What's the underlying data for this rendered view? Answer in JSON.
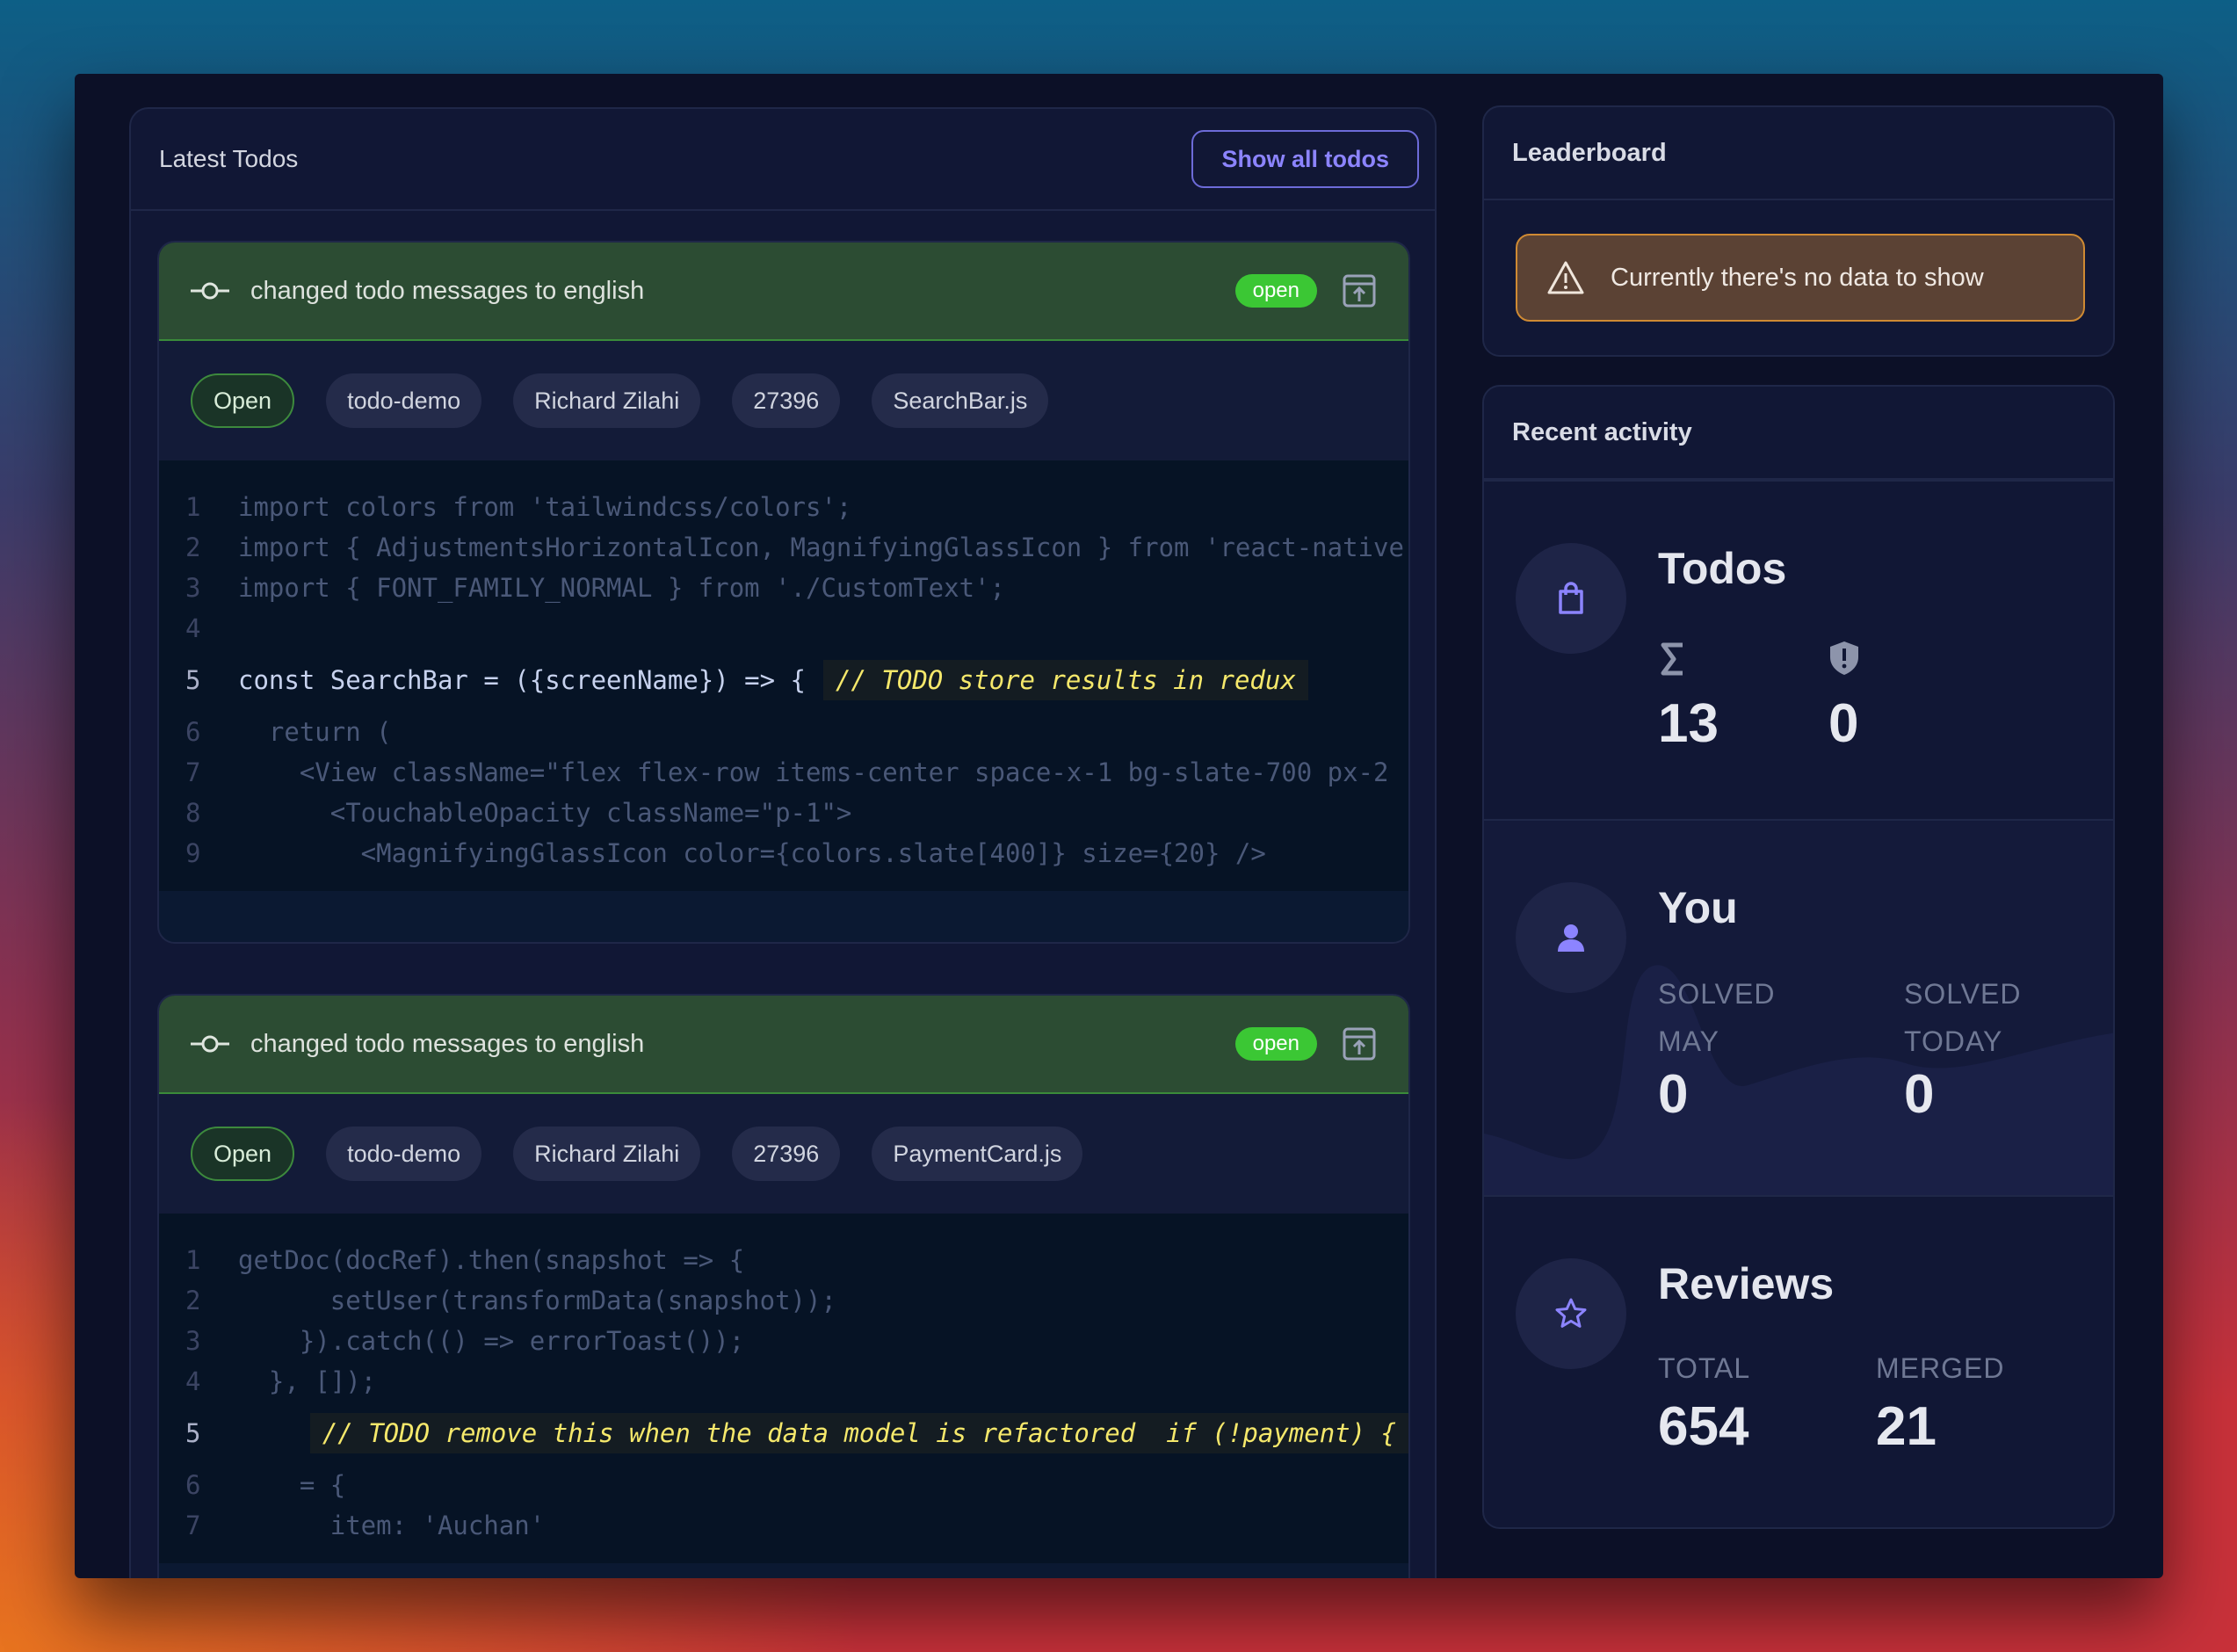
{
  "todos": {
    "title": "Latest Todos",
    "show_all_label": "Show all todos",
    "cards": [
      {
        "title": "changed todo messages to english",
        "status_pill": "open",
        "chips": [
          "Open",
          "todo-demo",
          "Richard Zilahi",
          "27396",
          "SearchBar.js"
        ],
        "code": [
          {
            "n": "1",
            "text": "import colors from 'tailwindcss/colors';"
          },
          {
            "n": "2",
            "text": "import { AdjustmentsHorizontalIcon, MagnifyingGlassIcon } from 'react-native"
          },
          {
            "n": "3",
            "text": "import { FONT_FAMILY_NORMAL } from './CustomText';"
          },
          {
            "n": "4",
            "text": ""
          },
          {
            "n": "5",
            "text": "const SearchBar = ({screenName}) => {",
            "comment": "// TODO store results in redux"
          },
          {
            "n": "6",
            "text": "  return ("
          },
          {
            "n": "7",
            "text": "    <View className=\"flex flex-row items-center space-x-1 bg-slate-700 px-2"
          },
          {
            "n": "8",
            "text": "      <TouchableOpacity className=\"p-1\">"
          },
          {
            "n": "9",
            "text": "        <MagnifyingGlassIcon color={colors.slate[400]} size={20} />"
          }
        ]
      },
      {
        "title": "changed todo messages to english",
        "status_pill": "open",
        "chips": [
          "Open",
          "todo-demo",
          "Richard Zilahi",
          "27396",
          "PaymentCard.js"
        ],
        "code": [
          {
            "n": "1",
            "text": "getDoc(docRef).then(snapshot => {"
          },
          {
            "n": "2",
            "text": "      setUser(transformData(snapshot));"
          },
          {
            "n": "3",
            "text": "    }).catch(() => errorToast());"
          },
          {
            "n": "4",
            "text": "  }, []);"
          },
          {
            "n": "5",
            "text": "    ",
            "comment": "// TODO remove this when the data model is refactored  if (!payment) {"
          },
          {
            "n": "6",
            "text": "    = {"
          },
          {
            "n": "7",
            "text": "      item: 'Auchan'"
          }
        ]
      }
    ]
  },
  "leaderboard": {
    "title": "Leaderboard",
    "alert_text": "Currently there's no data to show"
  },
  "recent_activity": {
    "title": "Recent activity",
    "todos": {
      "title": "Todos",
      "total_icon": "sigma-icon",
      "total_value": "13",
      "blocked_icon": "shield-icon",
      "blocked_value": "0"
    },
    "you": {
      "title": "You",
      "solved_month_label": "SOLVED\nMAY",
      "solved_month_value": "0",
      "solved_today_label": "SOLVED\nTODAY",
      "solved_today_value": "0"
    },
    "reviews": {
      "title": "Reviews",
      "total_label": "TOTAL",
      "total_value": "654",
      "merged_label": "MERGED",
      "merged_value": "21"
    }
  },
  "colors": {
    "accent": "#8c84ff",
    "open_green": "#3bc734",
    "todo_comment": "#f5e86b",
    "warning_border": "#cf8a33"
  }
}
